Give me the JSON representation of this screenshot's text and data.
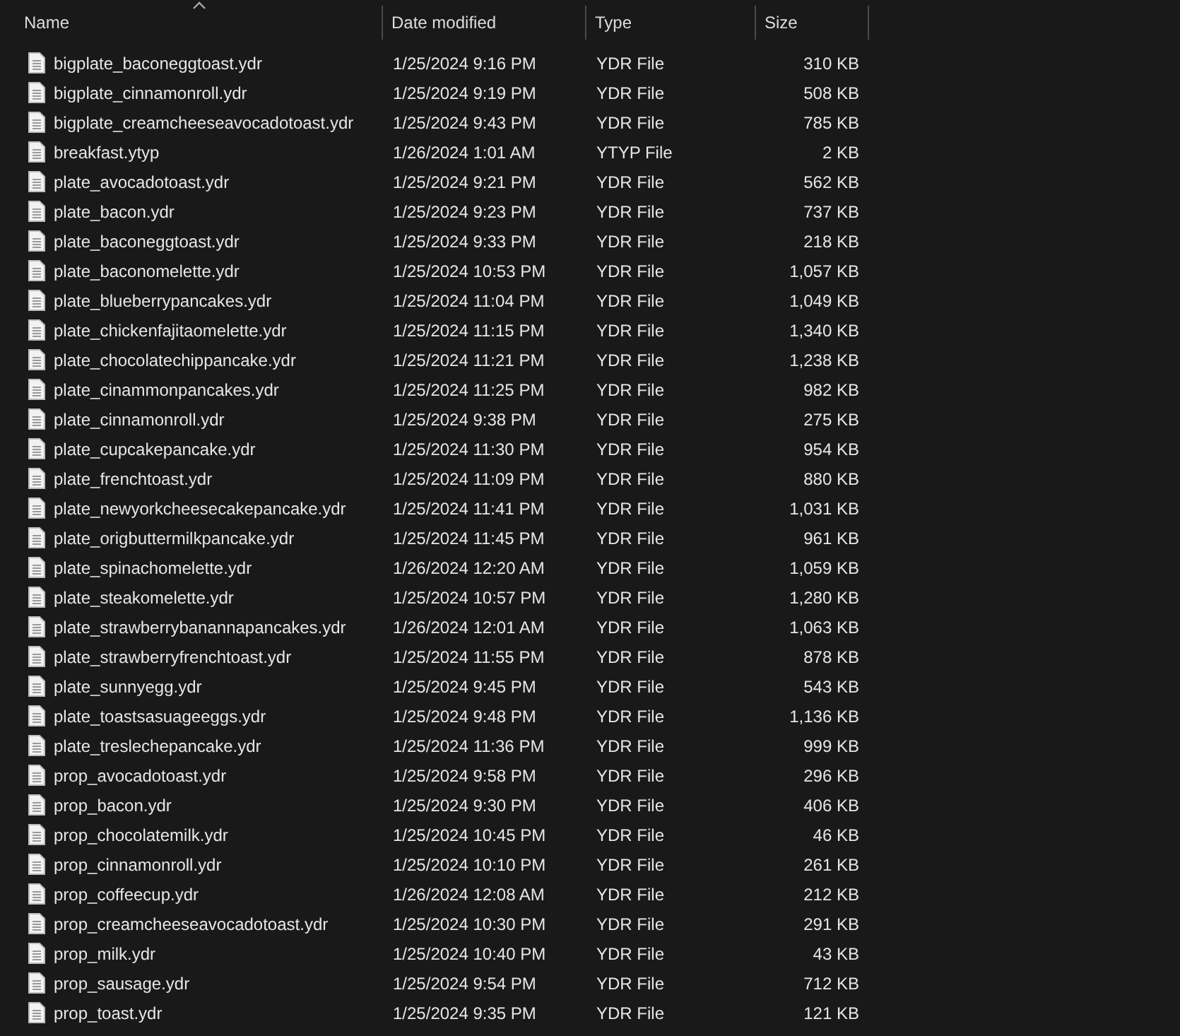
{
  "columns": [
    {
      "label": "Name",
      "sorted": true
    },
    {
      "label": "Date modified",
      "sorted": false
    },
    {
      "label": "Type",
      "sorted": false
    },
    {
      "label": "Size",
      "sorted": false
    }
  ],
  "rows": [
    [
      "bigplate_baconeggtoast.ydr",
      "1/25/2024 9:16 PM",
      "YDR File",
      "310 KB"
    ],
    [
      "bigplate_cinnamonroll.ydr",
      "1/25/2024 9:19 PM",
      "YDR File",
      "508 KB"
    ],
    [
      "bigplate_creamcheeseavocadotoast.ydr",
      "1/25/2024 9:43 PM",
      "YDR File",
      "785 KB"
    ],
    [
      "breakfast.ytyp",
      "1/26/2024 1:01 AM",
      "YTYP File",
      "2 KB"
    ],
    [
      "plate_avocadotoast.ydr",
      "1/25/2024 9:21 PM",
      "YDR File",
      "562 KB"
    ],
    [
      "plate_bacon.ydr",
      "1/25/2024 9:23 PM",
      "YDR File",
      "737 KB"
    ],
    [
      "plate_baconeggtoast.ydr",
      "1/25/2024 9:33 PM",
      "YDR File",
      "218 KB"
    ],
    [
      "plate_baconomelette.ydr",
      "1/25/2024 10:53 PM",
      "YDR File",
      "1,057 KB"
    ],
    [
      "plate_blueberrypancakes.ydr",
      "1/25/2024 11:04 PM",
      "YDR File",
      "1,049 KB"
    ],
    [
      "plate_chickenfajitaomelette.ydr",
      "1/25/2024 11:15 PM",
      "YDR File",
      "1,340 KB"
    ],
    [
      "plate_chocolatechippancake.ydr",
      "1/25/2024 11:21 PM",
      "YDR File",
      "1,238 KB"
    ],
    [
      "plate_cinammonpancakes.ydr",
      "1/25/2024 11:25 PM",
      "YDR File",
      "982 KB"
    ],
    [
      "plate_cinnamonroll.ydr",
      "1/25/2024 9:38 PM",
      "YDR File",
      "275 KB"
    ],
    [
      "plate_cupcakepancake.ydr",
      "1/25/2024 11:30 PM",
      "YDR File",
      "954 KB"
    ],
    [
      "plate_frenchtoast.ydr",
      "1/25/2024 11:09 PM",
      "YDR File",
      "880 KB"
    ],
    [
      "plate_newyorkcheesecakepancake.ydr",
      "1/25/2024 11:41 PM",
      "YDR File",
      "1,031 KB"
    ],
    [
      "plate_origbuttermilkpancake.ydr",
      "1/25/2024 11:45 PM",
      "YDR File",
      "961 KB"
    ],
    [
      "plate_spinachomelette.ydr",
      "1/26/2024 12:20 AM",
      "YDR File",
      "1,059 KB"
    ],
    [
      "plate_steakomelette.ydr",
      "1/25/2024 10:57 PM",
      "YDR File",
      "1,280 KB"
    ],
    [
      "plate_strawberrybanannapancakes.ydr",
      "1/26/2024 12:01 AM",
      "YDR File",
      "1,063 KB"
    ],
    [
      "plate_strawberryfrenchtoast.ydr",
      "1/25/2024 11:55 PM",
      "YDR File",
      "878 KB"
    ],
    [
      "plate_sunnyegg.ydr",
      "1/25/2024 9:45 PM",
      "YDR File",
      "543 KB"
    ],
    [
      "plate_toastsasuageeggs.ydr",
      "1/25/2024 9:48 PM",
      "YDR File",
      "1,136 KB"
    ],
    [
      "plate_treslechepancake.ydr",
      "1/25/2024 11:36 PM",
      "YDR File",
      "999 KB"
    ],
    [
      "prop_avocadotoast.ydr",
      "1/25/2024 9:58 PM",
      "YDR File",
      "296 KB"
    ],
    [
      "prop_bacon.ydr",
      "1/25/2024 9:30 PM",
      "YDR File",
      "406 KB"
    ],
    [
      "prop_chocolatemilk.ydr",
      "1/25/2024 10:45 PM",
      "YDR File",
      "46 KB"
    ],
    [
      "prop_cinnamonroll.ydr",
      "1/25/2024 10:10 PM",
      "YDR File",
      "261 KB"
    ],
    [
      "prop_coffeecup.ydr",
      "1/26/2024 12:08 AM",
      "YDR File",
      "212 KB"
    ],
    [
      "prop_creamcheeseavocadotoast.ydr",
      "1/25/2024 10:30 PM",
      "YDR File",
      "291 KB"
    ],
    [
      "prop_milk.ydr",
      "1/25/2024 10:40 PM",
      "YDR File",
      "43 KB"
    ],
    [
      "prop_sausage.ydr",
      "1/25/2024 9:54 PM",
      "YDR File",
      "712 KB"
    ],
    [
      "prop_toast.ydr",
      "1/25/2024 9:35 PM",
      "YDR File",
      "121 KB"
    ]
  ]
}
